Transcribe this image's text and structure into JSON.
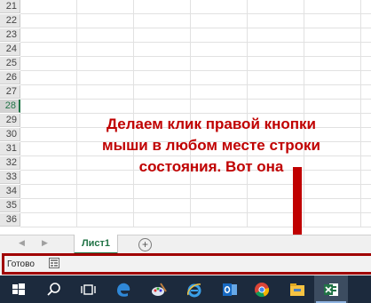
{
  "grid": {
    "row_numbers": [
      "21",
      "22",
      "23",
      "24",
      "25",
      "26",
      "27",
      "28",
      "29",
      "30",
      "31",
      "32",
      "33",
      "34",
      "35",
      "36"
    ],
    "active_row": "28"
  },
  "annotation": {
    "text": "Делаем клик правой кнопки\nмыши в любом месте строки\nсостояния. Вот она",
    "color": "#c00000"
  },
  "sheet_tabs": {
    "prev_icon": "triangle-left-icon",
    "next_icon": "triangle-right-icon",
    "active_sheet": "Лист1",
    "add_icon": "plus-circle-icon"
  },
  "status_bar": {
    "status_text": "Готово",
    "macro_icon": "macro-record-icon",
    "highlight_color": "#a00000"
  },
  "taskbar": {
    "items": [
      "start-windows-icon",
      "search-icon",
      "task-view-icon",
      "edge-icon",
      "paint-icon",
      "ie-icon",
      "outlook-icon",
      "chrome-icon",
      "file-explorer-icon",
      "excel-icon"
    ]
  },
  "colors": {
    "excel_green": "#217346",
    "taskbar_bg": "#1c2a3d"
  }
}
